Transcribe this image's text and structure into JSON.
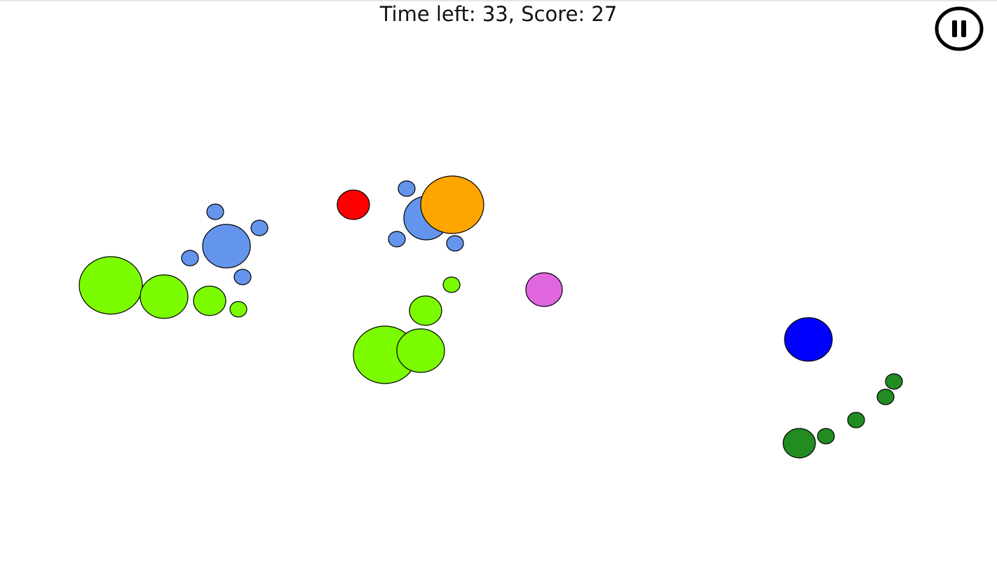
{
  "hud": {
    "time_label": "Time left:",
    "time_left": "33",
    "score_label": "Score:",
    "score": "27"
  },
  "pause_button": {
    "icon": "pause-icon"
  },
  "colors": {
    "lime": "#7CFC00",
    "cornflower": "#6495ED",
    "red": "#FF0000",
    "orange": "#FFA500",
    "orchid": "#E066E0",
    "blue": "#0000FF",
    "forest": "#228B22",
    "outline": "#000000"
  },
  "bubbles": [
    {
      "color": "lime"
    },
    {
      "color": "lime"
    },
    {
      "color": "lime"
    },
    {
      "color": "lime"
    },
    {
      "color": "cornflower"
    },
    {
      "color": "cornflower"
    },
    {
      "color": "cornflower"
    },
    {
      "color": "cornflower"
    },
    {
      "color": "cornflower"
    },
    {
      "color": "red"
    },
    {
      "color": "cornflower"
    },
    {
      "color": "cornflower"
    },
    {
      "color": "cornflower"
    },
    {
      "color": "cornflower"
    },
    {
      "color": "orange"
    },
    {
      "color": "lime"
    },
    {
      "color": "lime"
    },
    {
      "color": "lime"
    },
    {
      "color": "lime"
    },
    {
      "color": "orchid"
    },
    {
      "color": "blue"
    },
    {
      "color": "forest"
    },
    {
      "color": "forest"
    },
    {
      "color": "forest"
    },
    {
      "color": "forest"
    },
    {
      "color": "forest"
    }
  ]
}
